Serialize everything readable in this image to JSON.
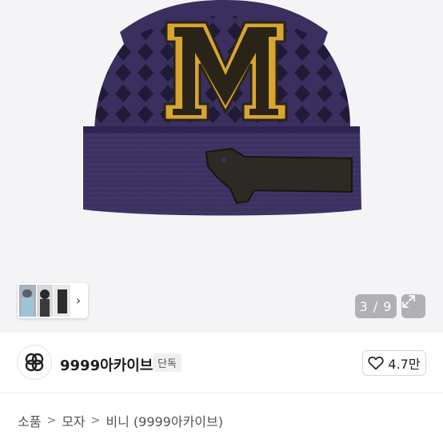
{
  "gallery": {
    "page_indicator": "3 / 9",
    "zoom_icon": "expand-icon",
    "thumb_chevron": "›",
    "colors": {
      "beanie": "#3a2f5e",
      "letter": "#d8a531",
      "letter_dark": "#2a2418",
      "dog": "#2b2a24"
    }
  },
  "seller": {
    "name": "9999아카이브",
    "badge": "단독",
    "like_count": "4.7만"
  },
  "breadcrumb": {
    "items": [
      "소품",
      "모자",
      "비니 (9999아카이브)"
    ],
    "separator": ">"
  }
}
